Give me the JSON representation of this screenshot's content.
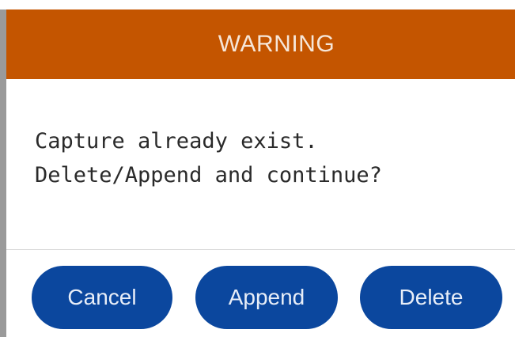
{
  "dialog": {
    "title": "WARNING",
    "message_lines": [
      "Capture already exist.",
      "Delete/Append and continue?"
    ],
    "buttons": {
      "cancel": "Cancel",
      "append": "Append",
      "delete": "Delete"
    }
  },
  "colors": {
    "header": "#c45500",
    "button": "#0b479e",
    "header_text": "#f6e6d8"
  }
}
